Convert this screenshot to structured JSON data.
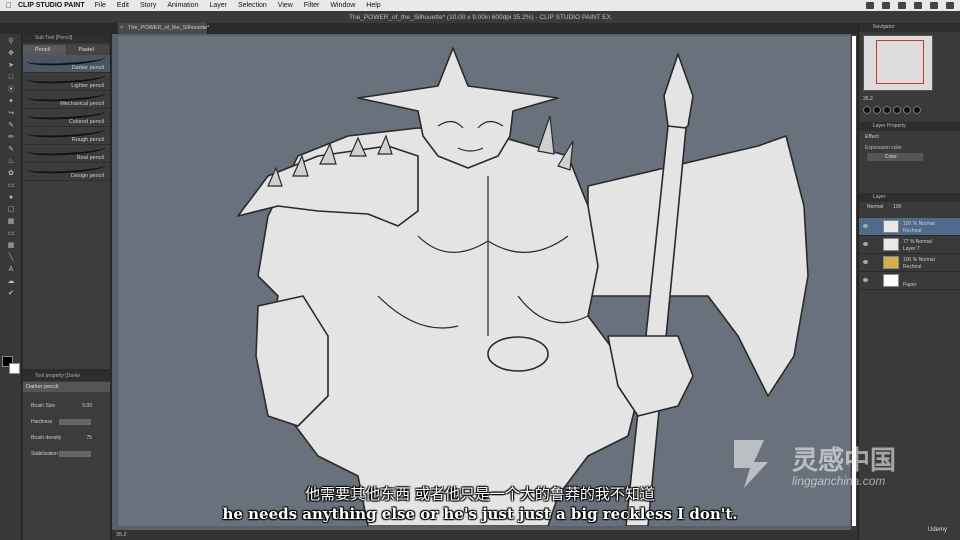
{
  "menubar": {
    "app_name": "CLIP STUDIO PAINT",
    "menus": [
      "File",
      "Edit",
      "Story",
      "Animation",
      "Layer",
      "Selection",
      "View",
      "Filter",
      "Window",
      "Help"
    ]
  },
  "window": {
    "title": "The_POWER_of_the_Silhouette* (10.00 x 9.00in 600dpi 35.2%) - CLIP STUDIO PAINT EX",
    "doc_tab": "The_POWER_of_the_Silhouette*"
  },
  "subtool": {
    "panel_title": "Sub Tool [Pencil]",
    "tabs": [
      "Pencil",
      "Pastel"
    ],
    "brushes": [
      "Darker pencil",
      "Lighter pencil",
      "Mechanical pencil",
      "Colored pencil",
      "Rough pencil",
      "Real pencil",
      "Design pencil"
    ],
    "active_index": 0
  },
  "tool_property": {
    "panel_title": "Tool property [Darke",
    "brush_name": "Darker pencil",
    "rows": [
      {
        "label": "Brush Size",
        "value": "5.00"
      },
      {
        "label": "Hardness",
        "value": ""
      },
      {
        "label": "Brush density",
        "value": "75"
      },
      {
        "label": "Stabilization",
        "value": ""
      }
    ]
  },
  "canvas": {
    "status_zoom": "35.2"
  },
  "navigator": {
    "title": "Navigator",
    "zoom_value": "35.2"
  },
  "layer_property": {
    "title": "Layer Property",
    "effect_label": "Effect",
    "expression_label": "Expression color",
    "expression_value": "Color"
  },
  "layers": {
    "title": "Layer",
    "blend_mode": "Normal",
    "opacity": "100",
    "items": [
      {
        "line1": "100 % Normal",
        "line2": "Rechnul",
        "active": true
      },
      {
        "line1": "77 % Normal",
        "line2": "Layer 7",
        "active": false
      },
      {
        "line1": "100 % Normal",
        "line2": "Rechnul",
        "active": false
      },
      {
        "line1": "",
        "line2": "Paper",
        "active": false
      }
    ]
  },
  "subtitles": {
    "chinese": "他需要其他东西 或者他只是一个大的鲁莽的我不知道",
    "english": "he needs anything else or he's just just a big reckless I don't."
  },
  "watermark": {
    "brand_cn": "灵感中国",
    "brand_en": "lingganchina.com",
    "udemy": "Udemy"
  }
}
